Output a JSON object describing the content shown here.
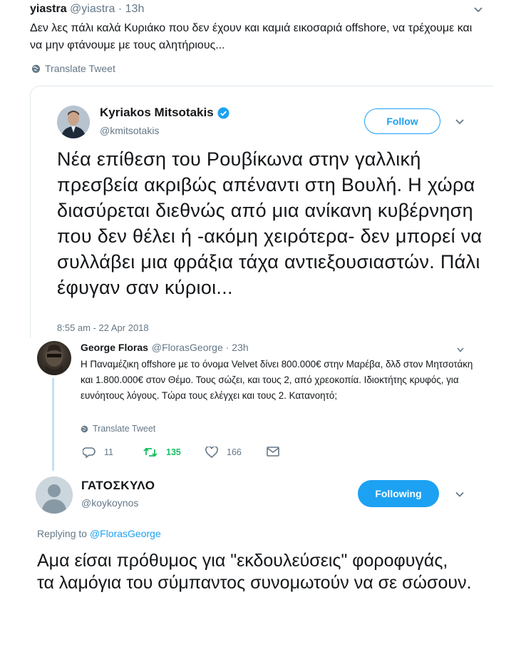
{
  "top_tweet": {
    "name": "yiastra",
    "handle": "@yiastra",
    "time": "· 13h",
    "text": "Δεν λες πάλι καλά Κυριάκο που δεν έχουν και καμιά εικοσαριά offshore, να τρέχουμε και να μην φτάνουμε με τους αλητήριους...",
    "translate_label": "Translate Tweet"
  },
  "quoted_tweet": {
    "name": "Kyriakos Mitsotakis",
    "handle": "@kmitsotakis",
    "follow_label": "Follow",
    "text": "Νέα επίθεση του Ρουβίκωνα στην γαλλική πρεσβεία ακριβώς απέναντι στη Βουλή. Η χώρα διασύρεται διεθνώς από μια ανίκανη κυβέρνηση που δεν θέλει ή -ακόμη χειρότερα- δεν μπορεί να συλλάβει μια φράξια τάχα αντιεξουσιαστών. Πάλι έφυγαν σαν κύριοι...",
    "timestamp": "8:55 am - 22 Apr 2018"
  },
  "reply_tweet": {
    "name": "George Floras",
    "handle": "@FlorasGeorge",
    "time": "· 23h",
    "text": "Η Παναμέζικη offshore με το όνομα Velvet δίνει 800.000€ στην Μαρέβα, δλδ στον Μητσοτάκη και 1.800.000€ στον Θέμο. Τους σώζει, και τους 2, από χρεοκοπία.  Ιδιοκτήτης κρυφός, για ευνόητους λόγους. Τώρα τους ελέγχει και τους 2. Κατανοητό;",
    "translate_label": "Translate Tweet",
    "replies": "11",
    "retweets": "135",
    "likes": "166"
  },
  "bottom_tweet": {
    "name": "ΓΑΤΟΣΚΥΛΟ",
    "handle": "@koykoynos",
    "following_label": "Following",
    "replying_prefix": "Replying to",
    "replying_to": "@FlorasGeorge",
    "text": "Αμα είσαι πρόθυμος για \"εκδουλεύσεις\" φοροφυγάς,\nτα λαμόγια του σύμπαντος συνομωτούν να σε σώσουν."
  },
  "colors": {
    "accent": "#1da1f2",
    "secondary_text": "#657786",
    "retweet_green": "#17bf63",
    "thread_line": "#c4e1f5"
  },
  "icons": [
    "chevron-down-icon",
    "globe-icon",
    "verified-badge-icon",
    "reply-icon",
    "retweet-icon",
    "like-icon",
    "message-icon"
  ]
}
